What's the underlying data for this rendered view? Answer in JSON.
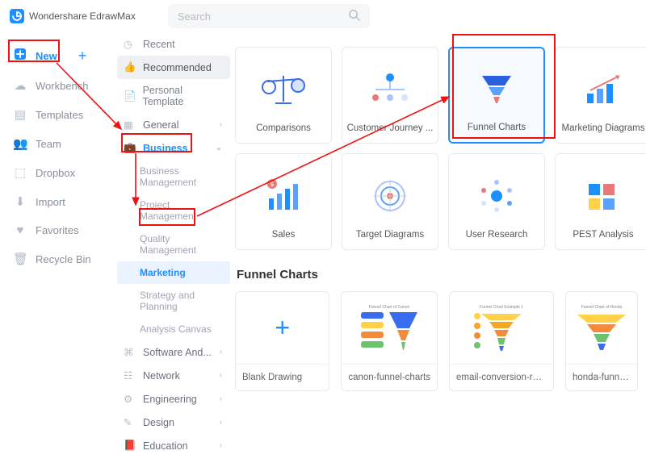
{
  "app": {
    "title": "Wondershare EdrawMax"
  },
  "search": {
    "placeholder": "Search"
  },
  "leftnav": {
    "new": "New",
    "items": [
      "Workbench",
      "Templates",
      "Team",
      "Dropbox",
      "Import",
      "Favorites",
      "Recycle Bin"
    ]
  },
  "midnav": {
    "toprow": [
      "Recent",
      "Recommended",
      "Personal Template"
    ],
    "categories": [
      {
        "name": "General",
        "open": false
      },
      {
        "name": "Business",
        "open": true,
        "children": [
          "Business Management",
          "Project Management",
          "Quality Management",
          "Marketing",
          "Strategy and Planning",
          "Analysis Canvas"
        ]
      },
      {
        "name": "Software And...",
        "open": false
      },
      {
        "name": "Network",
        "open": false
      },
      {
        "name": "Engineering",
        "open": false
      },
      {
        "name": "Design",
        "open": false
      },
      {
        "name": "Education",
        "open": false
      }
    ],
    "selected_sub": "Marketing"
  },
  "cards": [
    "Comparisons",
    "Customer Journey ...",
    "Funnel Charts",
    "Marketing Diagrams",
    "Sales",
    "Target Diagrams",
    "User Research",
    "PEST Analysis"
  ],
  "selected_card": "Funnel Charts",
  "section_title": "Funnel Charts",
  "templates": [
    "Blank Drawing",
    "canon-funnel-charts",
    "email-conversion-rate-of-c...",
    "honda-funnel-..."
  ]
}
